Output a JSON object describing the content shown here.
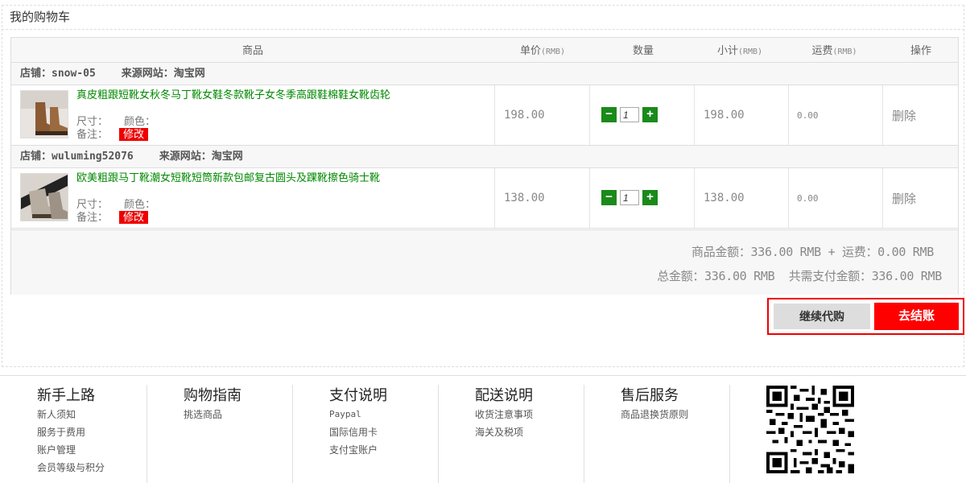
{
  "page": {
    "title": "我的购物车"
  },
  "table": {
    "headers": {
      "product": "商品",
      "unit_price": "单价",
      "quantity": "数量",
      "subtotal": "小计",
      "shipping": "运费",
      "action": "操作",
      "currency_unit": "(RMB)"
    }
  },
  "shops": [
    {
      "shop_label": "店铺：snow-05",
      "source_label": "来源网站：淘宝网",
      "items": [
        {
          "name": "真皮粗跟短靴女秋冬马丁靴女鞋冬款靴子女冬季高跟鞋棉鞋女靴齿轮",
          "size_label": "尺寸：",
          "color_label": "颜色：",
          "note_label": "备注：",
          "edit_label": "修改",
          "unit_price": "198.00",
          "qty": "1",
          "subtotal": "198.00",
          "shipping": "0.00",
          "delete_label": "删除"
        }
      ]
    },
    {
      "shop_label": "店铺：wuluming52076",
      "source_label": "来源网站：淘宝网",
      "items": [
        {
          "name": "欧美粗跟马丁靴潮女短靴短筒新款包邮复古圆头及踝靴擦色骑士靴",
          "size_label": "尺寸：",
          "color_label": "颜色：",
          "note_label": "备注：",
          "edit_label": "修改",
          "unit_price": "138.00",
          "qty": "1",
          "subtotal": "138.00",
          "shipping": "0.00",
          "delete_label": "删除"
        }
      ]
    }
  ],
  "summary": {
    "line1": "商品金额：336.00 RMB + 运费：0.00 RMB",
    "line2": "总金额：336.00 RMB  共需支付金额：336.00 RMB"
  },
  "buttons": {
    "continue": "继续代购",
    "checkout": "去结账"
  },
  "footer": {
    "columns": [
      {
        "title": "新手上路",
        "links": [
          "新人须知",
          "服务于费用",
          "账户管理",
          "会员等级与积分"
        ]
      },
      {
        "title": "购物指南",
        "links": [
          "挑选商品"
        ]
      },
      {
        "title": "支付说明",
        "links": [
          "Paypal",
          "国际信用卡",
          "支付宝账户"
        ]
      },
      {
        "title": "配送说明",
        "links": [
          "收货注意事项",
          "海关及税项"
        ]
      },
      {
        "title": "售后服务",
        "links": [
          "商品退换货原则"
        ]
      }
    ]
  },
  "colors": {
    "accent_red": "#ff0000",
    "product_green": "#008800",
    "qty_green": "#1a8a1a",
    "border": "#dddddd"
  },
  "icons": {
    "qty_minus": "minus-icon",
    "qty_plus": "plus-icon",
    "qr": "qr-code"
  }
}
